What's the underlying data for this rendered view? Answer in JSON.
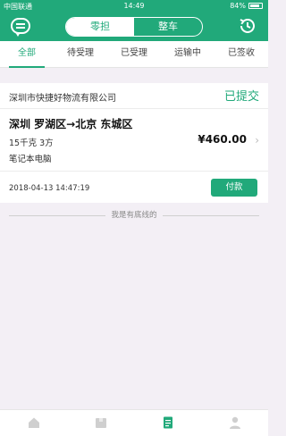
{
  "status_bar": {
    "carrier": "中国联通",
    "time": "14:49",
    "battery": "84%"
  },
  "header": {
    "segments": {
      "active": "零担",
      "inactive": "整车"
    }
  },
  "tabs": [
    {
      "label": "全部"
    },
    {
      "label": "待受理"
    },
    {
      "label": "已受理"
    },
    {
      "label": "运输中"
    },
    {
      "label": "已签收"
    }
  ],
  "order": {
    "company": "深圳市快捷好物流有限公司",
    "status": "已提交",
    "route": "深圳 罗湖区→北京 东城区",
    "spec": "15千克    3方",
    "goods": "笔记本电脑",
    "price": "¥460.00",
    "datetime": "2018-04-13 14:47:19",
    "pay_label": "付款"
  },
  "end_text": "我是有底线的",
  "colors": {
    "primary": "#21a97a",
    "background": "#f3eff5"
  },
  "tabbar": {
    "items": [
      {
        "icon": "home-icon"
      },
      {
        "icon": "goods-icon"
      },
      {
        "icon": "orders-icon"
      },
      {
        "icon": "user-icon"
      }
    ]
  }
}
